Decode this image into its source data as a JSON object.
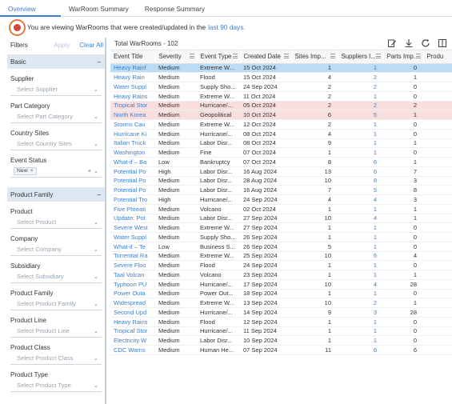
{
  "tabs": [
    {
      "label": "Overview",
      "active": true
    },
    {
      "label": "WarRoom Summary",
      "active": false
    },
    {
      "label": "Response Summary",
      "active": false
    }
  ],
  "info": {
    "text": "You are viewing WarRooms that were created/updated in the",
    "link": "last 90 days."
  },
  "filters": {
    "title": "Filters",
    "apply": "Apply",
    "clear_all": "Clear All",
    "basic": {
      "title": "Basic",
      "fields": [
        {
          "label": "Supplier",
          "placeholder": "Select Supplier"
        },
        {
          "label": "Part Category",
          "placeholder": "Select Part Category"
        },
        {
          "label": "Country Sites",
          "placeholder": "Select Country Sites"
        },
        {
          "label": "Event Status",
          "chip": "New"
        }
      ]
    },
    "product_family": {
      "title": "Product Family",
      "fields": [
        {
          "label": "Product",
          "placeholder": "Select Product"
        },
        {
          "label": "Company",
          "placeholder": "Select Company"
        },
        {
          "label": "Subsidiary",
          "placeholder": "Select Subsidiary"
        },
        {
          "label": "Product Family",
          "placeholder": "Select Product Family"
        },
        {
          "label": "Product Line",
          "placeholder": "Select Product Line"
        },
        {
          "label": "Product Class",
          "placeholder": "Select Product Class"
        },
        {
          "label": "Product Type",
          "placeholder": "Select Product Type"
        }
      ]
    }
  },
  "table": {
    "total_label": "Total WarRooms - 102",
    "columns": [
      "Event Title",
      "Severity",
      "Event Type",
      "Created Date",
      "Sites Imp...",
      "Suppliers I...",
      "Parts Imp...",
      "Produ"
    ],
    "rows": [
      {
        "title": "Heavy Rainf",
        "severity": "Medium",
        "type": "Extreme W...",
        "date": "15 Oct 2024",
        "sites": "1",
        "suppliers": "1",
        "parts": "0",
        "state": "selected"
      },
      {
        "title": "Heavy Rain",
        "severity": "Medium",
        "type": "Flood",
        "date": "15 Oct 2024",
        "sites": "4",
        "suppliers": "2",
        "parts": "1",
        "state": ""
      },
      {
        "title": "Water Suppl",
        "severity": "Medium",
        "type": "Supply Sho...",
        "date": "24 Sep 2024",
        "sites": "2",
        "suppliers": "2",
        "parts": "0",
        "state": ""
      },
      {
        "title": "Heavy Rains",
        "severity": "Medium",
        "type": "Extreme W...",
        "date": "11 Oct 2024",
        "sites": "2",
        "suppliers": "1",
        "parts": "0",
        "state": ""
      },
      {
        "title": "Tropical Stor",
        "severity": "Medium",
        "type": "Hurricane/...",
        "date": "05 Oct 2024",
        "sites": "2",
        "suppliers": "2",
        "parts": "2",
        "state": "highlight"
      },
      {
        "title": "North Korea",
        "severity": "Medium",
        "type": "Geopolitical",
        "date": "10 Oct 2024",
        "sites": "6",
        "suppliers": "5",
        "parts": "1",
        "state": "highlight"
      },
      {
        "title": "Storms Cau",
        "severity": "Medium",
        "type": "Extreme W...",
        "date": "12 Oct 2024",
        "sites": "2",
        "suppliers": "1",
        "parts": "0",
        "state": ""
      },
      {
        "title": "Hurricane Ki",
        "severity": "Medium",
        "type": "Hurricane/...",
        "date": "08 Oct 2024",
        "sites": "4",
        "suppliers": "1",
        "parts": "0",
        "state": ""
      },
      {
        "title": "Italian Truck",
        "severity": "Medium",
        "type": "Labor Disr...",
        "date": "08 Oct 2024",
        "sites": "9",
        "suppliers": "1",
        "parts": "1",
        "state": ""
      },
      {
        "title": "Washington",
        "severity": "Medium",
        "type": "Fine",
        "date": "07 Oct 2024",
        "sites": "1",
        "suppliers": "1",
        "parts": "0",
        "state": ""
      },
      {
        "title": "What-if – Ba",
        "severity": "Low",
        "type": "Bankruptcy",
        "date": "07 Oct 2024",
        "sites": "8",
        "suppliers": "6",
        "parts": "1",
        "state": ""
      },
      {
        "title": "Potential Po",
        "severity": "High",
        "type": "Labor Disr...",
        "date": "16 Aug 2024",
        "sites": "13",
        "suppliers": "6",
        "parts": "7",
        "state": ""
      },
      {
        "title": "Potential Po",
        "severity": "Medium",
        "type": "Labor Disr...",
        "date": "28 Aug 2024",
        "sites": "10",
        "suppliers": "8",
        "parts": "3",
        "state": ""
      },
      {
        "title": "Potential Po",
        "severity": "Medium",
        "type": "Labor Disr...",
        "date": "16 Aug 2024",
        "sites": "7",
        "suppliers": "5",
        "parts": "8",
        "state": ""
      },
      {
        "title": "Potential Tro",
        "severity": "High",
        "type": "Hurricane/...",
        "date": "24 Sep 2024",
        "sites": "4",
        "suppliers": "4",
        "parts": "3",
        "state": ""
      },
      {
        "title": "Five Phreati",
        "severity": "Medium",
        "type": "Volcano",
        "date": "02 Oct 2024",
        "sites": "1",
        "suppliers": "1",
        "parts": "1",
        "state": ""
      },
      {
        "title": "Update: Pot",
        "severity": "Medium",
        "type": "Labor Disr...",
        "date": "27 Sep 2024",
        "sites": "10",
        "suppliers": "4",
        "parts": "1",
        "state": ""
      },
      {
        "title": "Severe West",
        "severity": "Medium",
        "type": "Extreme W...",
        "date": "27 Sep 2024",
        "sites": "1",
        "suppliers": "1",
        "parts": "0",
        "state": ""
      },
      {
        "title": "Water Suppl",
        "severity": "Medium",
        "type": "Supply Sho...",
        "date": "26 Sep 2024",
        "sites": "1",
        "suppliers": "1",
        "parts": "0",
        "state": ""
      },
      {
        "title": "What-if – Te",
        "severity": "Low",
        "type": "Business S...",
        "date": "26 Sep 2024",
        "sites": "5",
        "suppliers": "1",
        "parts": "0",
        "state": ""
      },
      {
        "title": "Torrential Ra",
        "severity": "Medium",
        "type": "Extreme W...",
        "date": "25 Sep 2024",
        "sites": "10",
        "suppliers": "6",
        "parts": "4",
        "state": ""
      },
      {
        "title": "Severe Floo",
        "severity": "Medium",
        "type": "Flood",
        "date": "24 Sep 2024",
        "sites": "1",
        "suppliers": "1",
        "parts": "0",
        "state": ""
      },
      {
        "title": "Taal Volcan",
        "severity": "Medium",
        "type": "Volcano",
        "date": "23 Sep 2024",
        "sites": "1",
        "suppliers": "1",
        "parts": "1",
        "state": ""
      },
      {
        "title": "Typhoon PU",
        "severity": "Medium",
        "type": "Hurricane/...",
        "date": "17 Sep 2024",
        "sites": "10",
        "suppliers": "4",
        "parts": "28",
        "state": ""
      },
      {
        "title": "Power Outa",
        "severity": "Medium",
        "type": "Power Out...",
        "date": "18 Sep 2024",
        "sites": "1",
        "suppliers": "1",
        "parts": "0",
        "state": ""
      },
      {
        "title": "Widespread",
        "severity": "Medium",
        "type": "Extreme W...",
        "date": "13 Sep 2024",
        "sites": "10",
        "suppliers": "2",
        "parts": "1",
        "state": ""
      },
      {
        "title": "Second Upd",
        "severity": "Medium",
        "type": "Hurricane/...",
        "date": "14 Sep 2024",
        "sites": "9",
        "suppliers": "3",
        "parts": "28",
        "state": ""
      },
      {
        "title": "Heavy Rains",
        "severity": "Medium",
        "type": "Flood",
        "date": "12 Sep 2024",
        "sites": "1",
        "suppliers": "1",
        "parts": "0",
        "state": ""
      },
      {
        "title": "Tropical Stor",
        "severity": "Medium",
        "type": "Hurricane/...",
        "date": "11 Sep 2024",
        "sites": "1",
        "suppliers": "1",
        "parts": "0",
        "state": ""
      },
      {
        "title": "Electricity W",
        "severity": "Medium",
        "type": "Labor Disr...",
        "date": "10 Sep 2024",
        "sites": "1",
        "suppliers": "1",
        "parts": "0",
        "state": ""
      },
      {
        "title": "CDC Warns",
        "severity": "Medium",
        "type": "Human He...",
        "date": "07 Sep 2024",
        "sites": "11",
        "suppliers": "6",
        "parts": "6",
        "state": ""
      }
    ]
  }
}
